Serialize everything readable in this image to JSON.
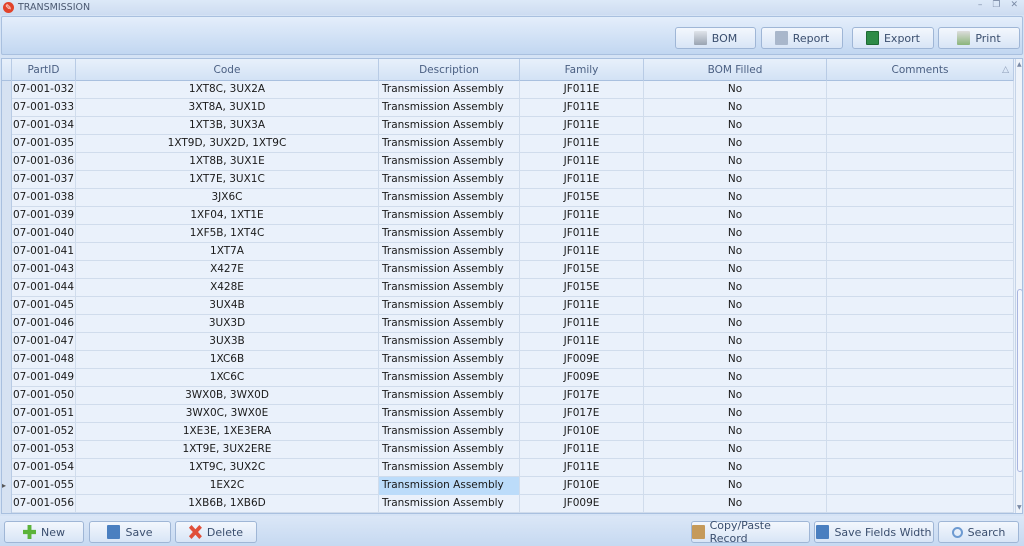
{
  "window": {
    "title": "TRANSMISSION",
    "minimize": "–",
    "restore": "❐",
    "close": "✕"
  },
  "toolbar": {
    "bom": "BOM",
    "report": "Report",
    "export": "Export",
    "print": "Print"
  },
  "columns": [
    "PartID",
    "Code",
    "Description",
    "Family",
    "BOM Filled",
    "Comments"
  ],
  "sort_indicator": "△",
  "rows": [
    [
      "07-001-032",
      "1XT8C, 3UX2A",
      "Transmission Assembly",
      "JF011E",
      "No",
      ""
    ],
    [
      "07-001-033",
      "3XT8A, 3UX1D",
      "Transmission Assembly",
      "JF011E",
      "No",
      ""
    ],
    [
      "07-001-034",
      "1XT3B, 3UX3A",
      "Transmission Assembly",
      "JF011E",
      "No",
      ""
    ],
    [
      "07-001-035",
      "1XT9D, 3UX2D, 1XT9C",
      "Transmission Assembly",
      "JF011E",
      "No",
      ""
    ],
    [
      "07-001-036",
      "1XT8B, 3UX1E",
      "Transmission Assembly",
      "JF011E",
      "No",
      ""
    ],
    [
      "07-001-037",
      "1XT7E, 3UX1C",
      "Transmission Assembly",
      "JF011E",
      "No",
      ""
    ],
    [
      "07-001-038",
      "3JX6C",
      "Transmission Assembly",
      "JF015E",
      "No",
      ""
    ],
    [
      "07-001-039",
      "1XF04, 1XT1E",
      "Transmission Assembly",
      "JF011E",
      "No",
      ""
    ],
    [
      "07-001-040",
      "1XF5B, 1XT4C",
      "Transmission Assembly",
      "JF011E",
      "No",
      ""
    ],
    [
      "07-001-041",
      "1XT7A",
      "Transmission Assembly",
      "JF011E",
      "No",
      ""
    ],
    [
      "07-001-043",
      "X427E",
      "Transmission Assembly",
      "JF015E",
      "No",
      ""
    ],
    [
      "07-001-044",
      "X428E",
      "Transmission Assembly",
      "JF015E",
      "No",
      ""
    ],
    [
      "07-001-045",
      "3UX4B",
      "Transmission Assembly",
      "JF011E",
      "No",
      ""
    ],
    [
      "07-001-046",
      "3UX3D",
      "Transmission Assembly",
      "JF011E",
      "No",
      ""
    ],
    [
      "07-001-047",
      "3UX3B",
      "Transmission Assembly",
      "JF011E",
      "No",
      ""
    ],
    [
      "07-001-048",
      "1XC6B",
      "Transmission Assembly",
      "JF009E",
      "No",
      ""
    ],
    [
      "07-001-049",
      "1XC6C",
      "Transmission Assembly",
      "JF009E",
      "No",
      ""
    ],
    [
      "07-001-050",
      "3WX0B, 3WX0D",
      "Transmission Assembly",
      "JF017E",
      "No",
      ""
    ],
    [
      "07-001-051",
      "3WX0C, 3WX0E",
      "Transmission Assembly",
      "JF017E",
      "No",
      ""
    ],
    [
      "07-001-052",
      "1XE3E, 1XE3ERA",
      "Transmission Assembly",
      "JF010E",
      "No",
      ""
    ],
    [
      "07-001-053",
      "1XT9E, 3UX2ERE",
      "Transmission Assembly",
      "JF011E",
      "No",
      ""
    ],
    [
      "07-001-054",
      "1XT9C, 3UX2C",
      "Transmission Assembly",
      "JF011E",
      "No",
      ""
    ],
    [
      "07-001-055",
      "1EX2C",
      "Transmission Assembly",
      "JF010E",
      "No",
      ""
    ],
    [
      "07-001-056",
      "1XB6B, 1XB6D",
      "Transmission Assembly",
      "JF009E",
      "No",
      ""
    ]
  ],
  "selected_row": 22,
  "footer": {
    "new": "New",
    "save": "Save",
    "delete": "Delete",
    "copy_paste": "Copy/Paste Record",
    "save_widths": "Save Fields Width",
    "search": "Search"
  }
}
